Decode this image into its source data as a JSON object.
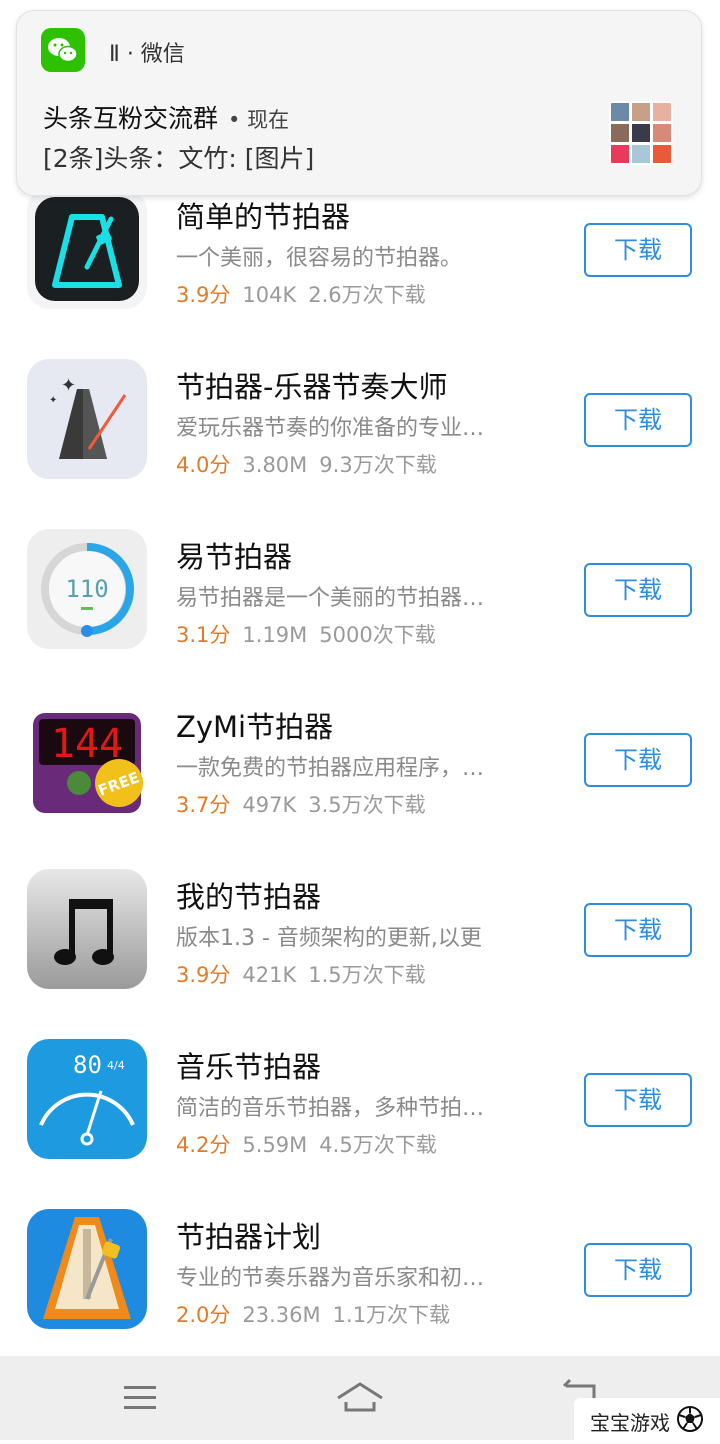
{
  "notification": {
    "app_name": "Ⅱ · 微信",
    "title": "头条互粉交流群",
    "time": "• 现在",
    "body": "[2条]头条：文竹: [图片]"
  },
  "apps": [
    {
      "name": "简单的节拍器",
      "desc": "一个美丽，很容易的节拍器。",
      "score": "3.9分",
      "size": "104K",
      "downloads": "2.6万次下载",
      "button": "下载",
      "icon": "metronome-neon-icon"
    },
    {
      "name": "节拍器-乐器节奏大师",
      "desc": "爱玩乐器节奏的你准备的专业…",
      "score": "4.0分",
      "size": "3.80M",
      "downloads": "9.3万次下载",
      "button": "下载",
      "icon": "metronome-dark-icon"
    },
    {
      "name": "易节拍器",
      "desc": "易节拍器是一个美丽的节拍器…",
      "score": "3.1分",
      "size": "1.19M",
      "downloads": "5000次下载",
      "button": "下载",
      "icon": "dial-110-icon",
      "icon_text": "110"
    },
    {
      "name": "ZyMi节拍器",
      "desc": "一款免费的节拍器应用程序，…",
      "score": "3.7分",
      "size": "497K",
      "downloads": "3.5万次下载",
      "button": "下载",
      "icon": "digital-144-icon",
      "icon_text": "144",
      "badge": "FREE"
    },
    {
      "name": "我的节拍器",
      "desc": "版本1.3 - 音频架构的更新,以更",
      "score": "3.9分",
      "size": "421K",
      "downloads": "1.5万次下载",
      "button": "下载",
      "icon": "music-note-icon"
    },
    {
      "name": "音乐节拍器",
      "desc": "简洁的音乐节拍器，多种节拍…",
      "score": "4.2分",
      "size": "5.59M",
      "downloads": "4.5万次下载",
      "button": "下载",
      "icon": "gauge-80-icon",
      "icon_text": "80",
      "icon_sub": "4/4"
    },
    {
      "name": "节拍器计划",
      "desc": "专业的节奏乐器为音乐家和初…",
      "score": "2.0分",
      "size": "23.36M",
      "downloads": "1.1万次下载",
      "button": "下载",
      "icon": "metronome-orange-icon"
    }
  ],
  "navbar": {
    "items": [
      "menu",
      "home",
      "back"
    ]
  },
  "watermark": {
    "text": "宝宝游戏"
  },
  "colors": {
    "accent": "#2d8ee0",
    "score": "#e07b2a",
    "wechat": "#2dc100"
  }
}
